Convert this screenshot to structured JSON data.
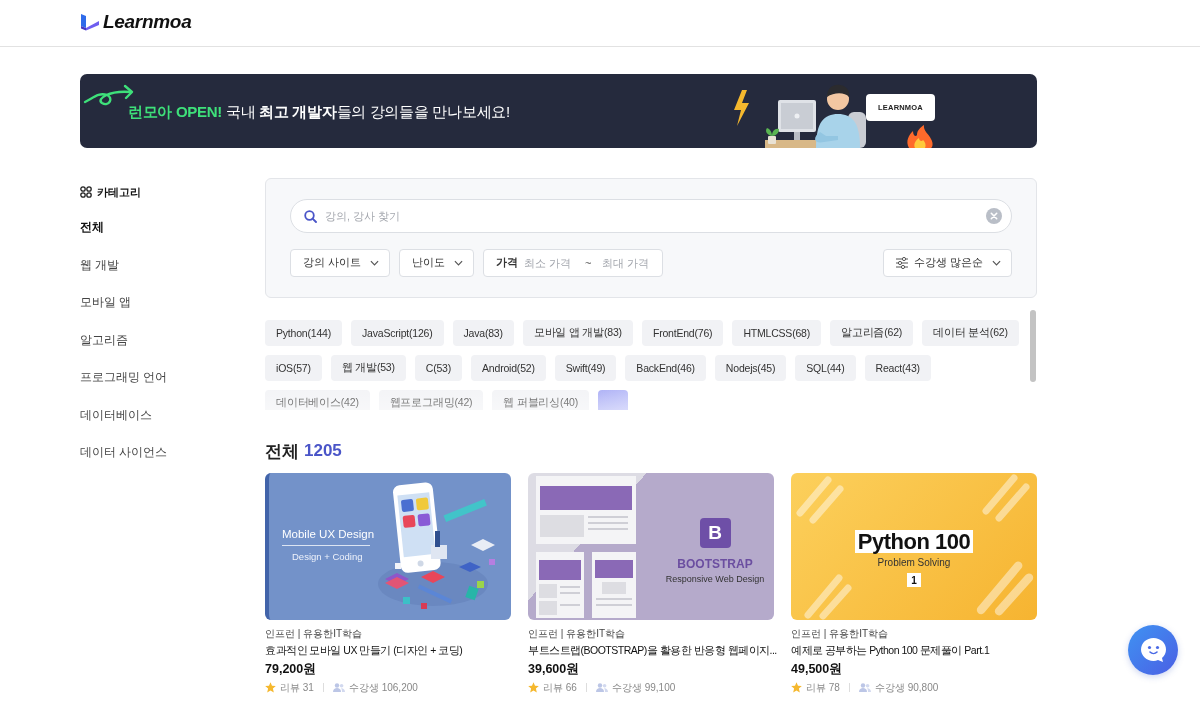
{
  "header": {
    "logo": "Learnmoa"
  },
  "banner": {
    "headline": "**런모아 OPEN!** 국내 **최고 개발자**들의 강의들을 만나보세요!",
    "bubble": "LEARNMOA"
  },
  "sidebar": {
    "title": "카테고리",
    "items": [
      {
        "label": "전체",
        "selected": true
      },
      {
        "label": "웹 개발",
        "selected": false
      },
      {
        "label": "모바일 앱",
        "selected": false
      },
      {
        "label": "알고리즘",
        "selected": false
      },
      {
        "label": "프로그래밍 언어",
        "selected": false
      },
      {
        "label": "데이터베이스",
        "selected": false
      },
      {
        "label": "데이터 사이언스",
        "selected": false
      }
    ]
  },
  "search": {
    "placeholder": "강의, 강사 찾기"
  },
  "filters": [
    {
      "kind": "dropdown",
      "label": "강의 사이트"
    },
    {
      "kind": "dropdown",
      "label": "난이도"
    },
    {
      "kind": "range",
      "label": "가격",
      "min_placeholder": "최소 가격",
      "separator": "~",
      "max_placeholder": "최대 가격"
    }
  ],
  "sort": {
    "label": "수강생 많은순"
  },
  "tags": [
    "Python(144)",
    "JavaScript(126)",
    "Java(83)",
    "모바일 앱 개발(83)",
    "FrontEnd(76)",
    "HTMLCSS(68)",
    "알고리즘(62)",
    "데이터 분석(62)",
    "iOS(57)",
    "웹 개발(53)",
    "C(53)",
    "Android(52)",
    "Swift(49)",
    "BackEnd(46)",
    "Nodejs(45)",
    "SQL(44)",
    "React(43)",
    "데이터베이스(42)",
    "웹프로그래밍(42)",
    "웹 퍼블리싱(40)"
  ],
  "results": {
    "title": "전체",
    "count": "1205"
  },
  "courses": [
    {
      "thumbnail": {
        "kind": "mobile",
        "title": "Mobile UX Design",
        "subtitle": "Design + Coding"
      },
      "provider": "인프런 | 유용한IT학습",
      "title": "효과적인 모바일 UX 만들기 (디자인 + 코딩)",
      "price": "79,200원",
      "reviews": "리뷰 31",
      "students": "수강생 106,200"
    },
    {
      "thumbnail": {
        "kind": "bootstrap",
        "logo_letter": "B",
        "title": "BOOTSTRAP",
        "subtitle": "Responsive Web Design"
      },
      "provider": "인프런 | 유용한IT학습",
      "title": "부트스트랩(BOOTSTRAP)을 활용한 반응형 웹페이지...",
      "price": "39,600원",
      "reviews": "리뷰 66",
      "students": "수강생 99,100"
    },
    {
      "thumbnail": {
        "kind": "python",
        "title": "Python 100",
        "subtitle": "Problem Solving",
        "badge": "1"
      },
      "provider": "인프런 | 유용한IT학습",
      "title": "예제로 공부하는 Python 100 문제풀이 Part.1",
      "price": "49,500원",
      "reviews": "리뷰 78",
      "students": "수강생 90,800"
    }
  ]
}
